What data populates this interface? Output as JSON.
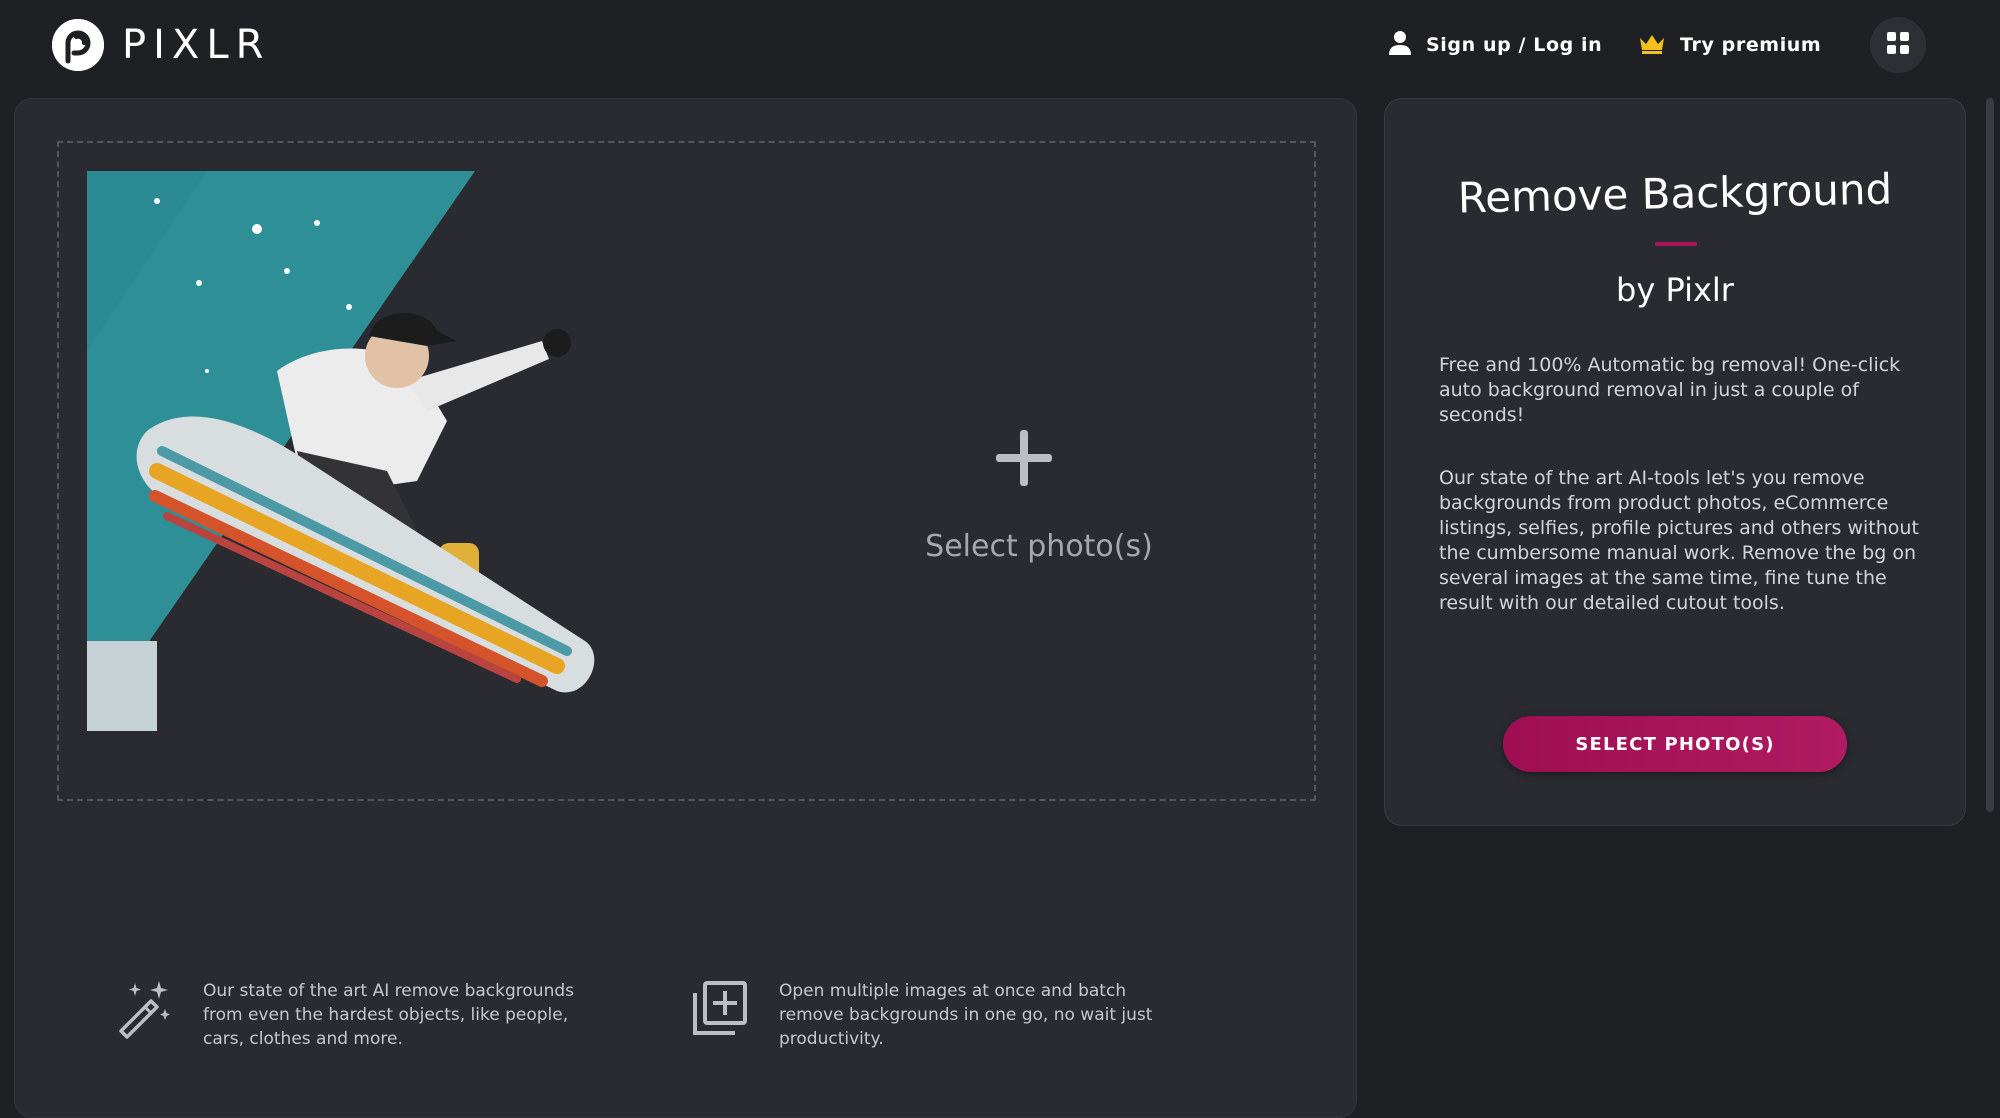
{
  "header": {
    "logo_text": "PIXLR",
    "login_label": "Sign up / Log in",
    "premium_label": "Try premium"
  },
  "dropzone": {
    "label": "Select photo(s)"
  },
  "features": [
    {
      "icon": "magic-wand-icon",
      "text": "Our state of the art AI remove backgrounds from even the hardest objects, like people, cars, clothes and more."
    },
    {
      "icon": "add-multiple-images-icon",
      "text": "Open multiple images at once and batch remove backgrounds in one go, no wait just productivity."
    }
  ],
  "side_panel": {
    "title": "Remove Background",
    "subtitle": "by Pixlr",
    "paragraph_1": "Free and 100% Automatic bg removal! One-click auto background removal in just a couple of seconds!",
    "paragraph_2": "Our state of the art AI-tools let's you remove backgrounds from product photos, eCommerce listings, selfies, profile pictures and others without the cumbersome manual work. Remove the bg on several images at the same time, fine tune the result with our detailed cutout tools.",
    "button_label": "SELECT PHOTO(S)"
  },
  "colors": {
    "background": "#1f2024",
    "panel": "#2a2b30",
    "accent": "#a8155a",
    "crown": "#f2c01a"
  }
}
